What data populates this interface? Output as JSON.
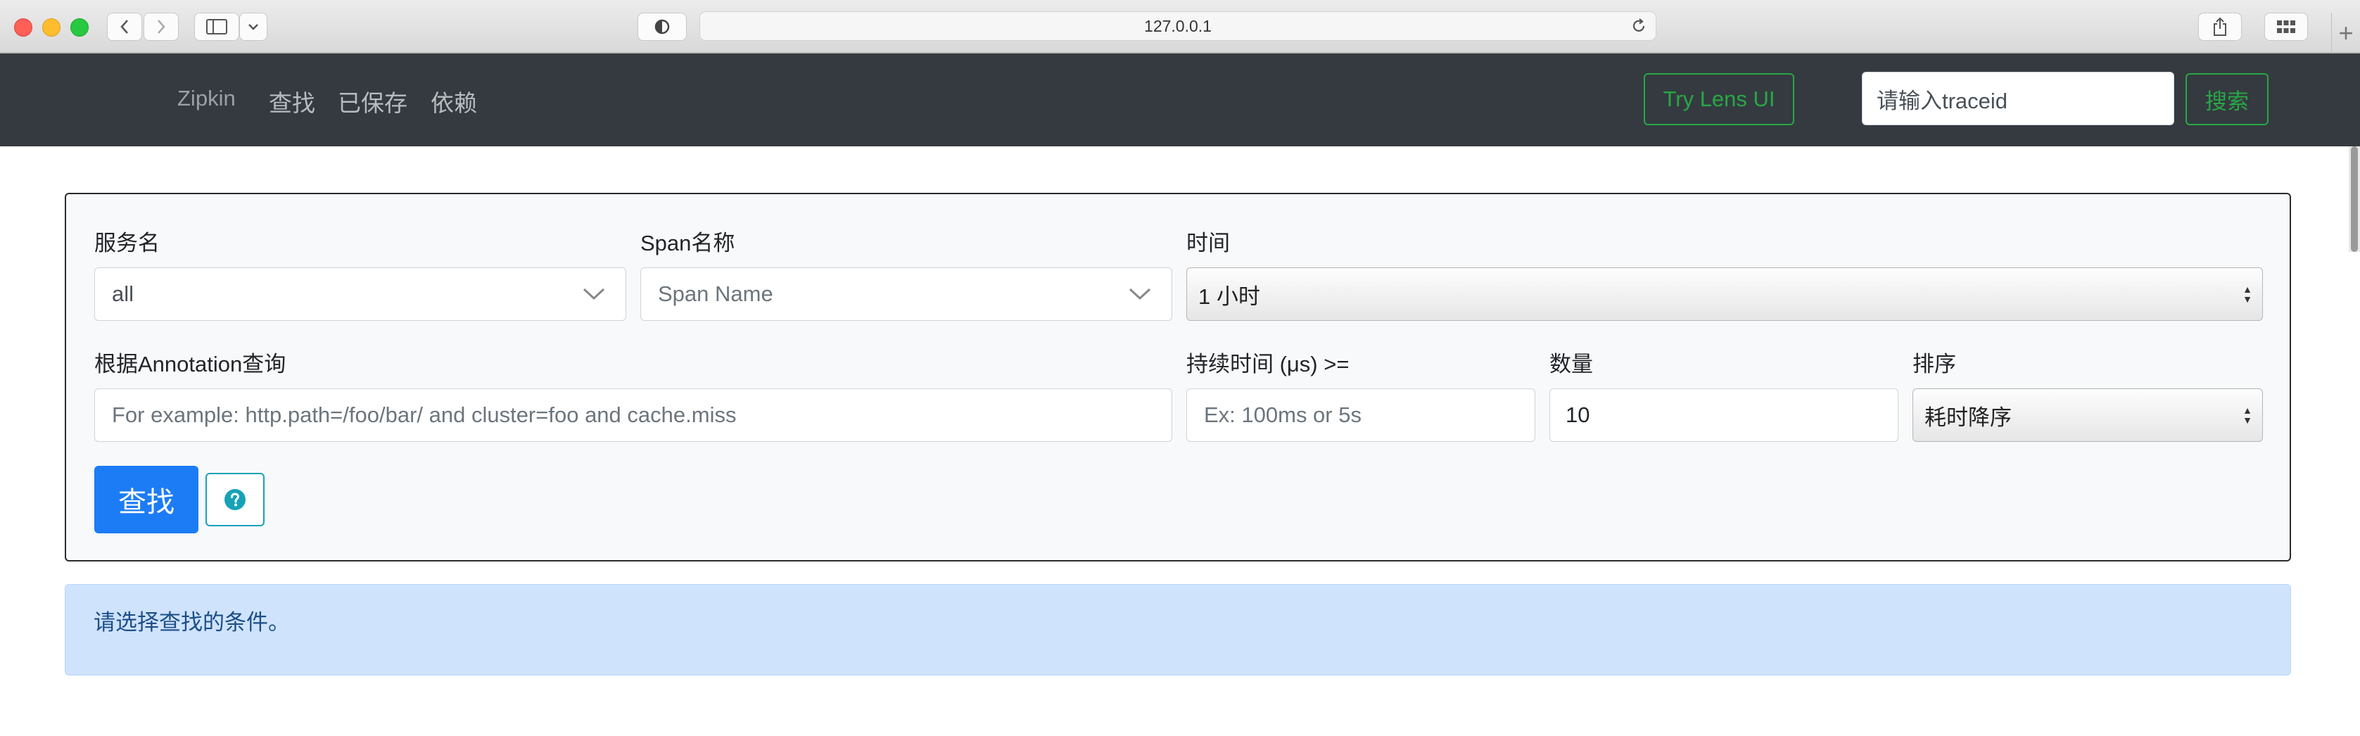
{
  "browser": {
    "url": "127.0.0.1"
  },
  "navbar": {
    "brand": "Zipkin",
    "links": [
      "查找",
      "已保存",
      "依赖"
    ],
    "lens_button": "Try Lens UI",
    "traceid_placeholder": "请输入traceid",
    "search_button": "搜索"
  },
  "form": {
    "service": {
      "label": "服务名",
      "value": "all"
    },
    "span": {
      "label": "Span名称",
      "value": "Span Name"
    },
    "time": {
      "label": "时间",
      "value": "1 小时"
    },
    "annotation": {
      "label": "根据Annotation查询",
      "placeholder": "For example: http.path=/foo/bar/ and cluster=foo and cache.miss"
    },
    "duration": {
      "label": "持续时间 (μs) >=",
      "placeholder": "Ex: 100ms or 5s"
    },
    "limit": {
      "label": "数量",
      "value": "10"
    },
    "sort": {
      "label": "排序",
      "value": "耗时降序"
    },
    "find_button": "查找",
    "help_icon": "question-circle-icon"
  },
  "alert": {
    "message": "请选择查找的条件。"
  },
  "colors": {
    "navbar_bg": "#343a40",
    "primary": "#1c7cf5",
    "success": "#28a745",
    "info": "#17a2b8",
    "alert_bg": "#cfe3fc"
  }
}
